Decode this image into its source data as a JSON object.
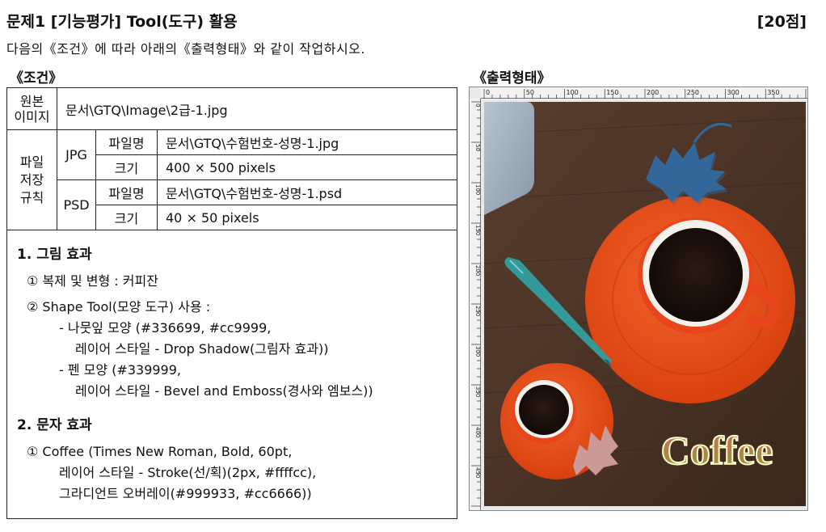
{
  "header": {
    "title": "문제1 [기능평가] Tool(도구) 활용",
    "score": "[20점]",
    "instruction": "다음의《조건》에 따라 아래의《출력형태》와 같이 작업하시오."
  },
  "conditions": {
    "heading": "《조건》",
    "source_label": "원본 이미지",
    "source_label_lines": [
      "원본",
      "이미지"
    ],
    "source_value": "문서\\GTQ\\Image\\2급-1.jpg",
    "save_label_lines": [
      "파일",
      "저장",
      "규칙"
    ],
    "jpg_label": "JPG",
    "psd_label": "PSD",
    "filename_label": "파일명",
    "size_label": "크기",
    "jpg_filename": "문서\\GTQ\\수험번호-성명-1.jpg",
    "jpg_size": "400 × 500 pixels",
    "psd_filename": "문서\\GTQ\\수험번호-성명-1.psd",
    "psd_size": "40 × 50 pixels"
  },
  "effects": {
    "image_heading": "1. 그림 효과",
    "image_items": [
      "① 복제 및 변형 : 커피잔",
      "② Shape Tool(모양 도구) 사용 :",
      "- 나뭇잎 모양 (#336699, #cc9999,",
      "레이어 스타일 - Drop Shadow(그림자 효과))",
      "- 펜 모양 (#339999,",
      "레이어 스타일 - Bevel and Emboss(경사와 엠보스))"
    ],
    "text_heading": "2. 문자 효과",
    "text_items": [
      "① Coffee (Times New Roman, Bold, 60pt,",
      "레이어 스타일 - Stroke(선/획)(2px, #ffffcc),",
      "그라디언트 오버레이(#999933, #cc6666))"
    ]
  },
  "output": {
    "heading": "《출력형태》",
    "ruler_labels": [
      "0",
      "50",
      "100",
      "150",
      "200",
      "250",
      "300",
      "350"
    ],
    "ruler_side_labels": [
      "0",
      "50",
      "100",
      "150",
      "200",
      "250",
      "300",
      "350",
      "400",
      "450"
    ],
    "coffee_text": "Coffee",
    "colors": {
      "wood": "#4a3326",
      "saucer": "#e8451c",
      "leaf_blue": "#336699",
      "leaf_pink": "#cc9999",
      "pen": "#339999",
      "text_grad_start": "#999933",
      "text_grad_end": "#cc6666",
      "text_stroke": "#ffffcc"
    }
  }
}
